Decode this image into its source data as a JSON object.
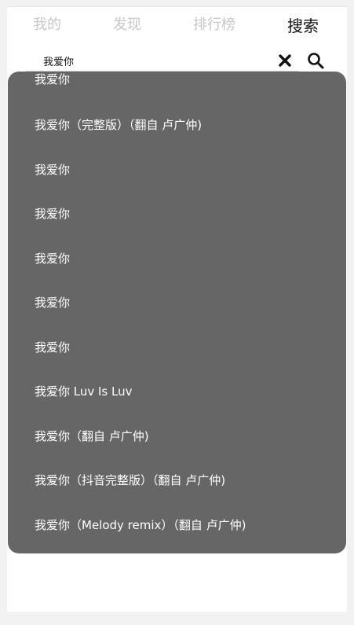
{
  "tabs": [
    {
      "label": "我的"
    },
    {
      "label": "发现"
    },
    {
      "label": "排行榜"
    },
    {
      "label": "搜索"
    }
  ],
  "search": {
    "value": "我爱你"
  },
  "colors": {
    "dropdown_bg": "#666666",
    "active_tab": "#111111",
    "inactive_tab": "#c7c7c7"
  },
  "suggestions": [
    "我爱你",
    "我爱你（完整版）（翻自 卢广仲)",
    "我爱你",
    "我爱你",
    "我爱你",
    "我爱你",
    "我爱你",
    "我爱你 Luv Is Luv",
    "我爱你（翻自 卢广仲)",
    "我爱你（抖音完整版）（翻自 卢广仲)",
    "我爱你（Melody remix）（翻自 卢广仲)"
  ]
}
